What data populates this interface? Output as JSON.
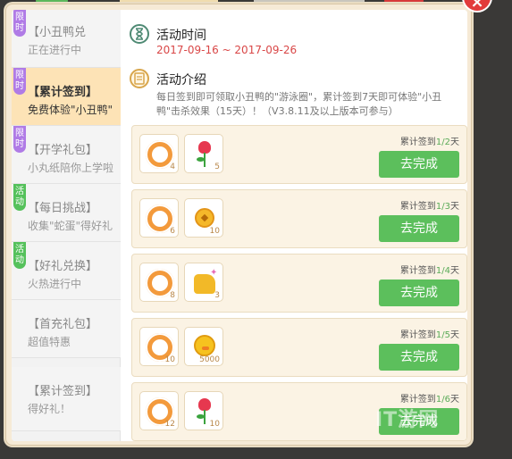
{
  "close_label": "×",
  "sidebar": {
    "items": [
      {
        "tag": "限时",
        "tag_color": "purple",
        "title": "【小丑鸭兑",
        "sub": "正在进行中",
        "active": false
      },
      {
        "tag": "限时",
        "tag_color": "purple",
        "title": "【累计签到】",
        "sub": "免费体验\"小丑鸭\"",
        "active": true
      },
      {
        "tag": "限时",
        "tag_color": "purple",
        "title": "【开学礼包】",
        "sub": "小丸纸陪你上学啦",
        "active": false
      },
      {
        "tag": "活动",
        "tag_color": "green",
        "title": "【每日挑战】",
        "sub": "收集\"蛇蛋\"得好礼",
        "active": false
      },
      {
        "tag": "活动",
        "tag_color": "green",
        "title": "【好礼兑换】",
        "sub": "火热进行中",
        "active": false
      },
      {
        "tag": "",
        "tag_color": "",
        "title": "【首充礼包】",
        "sub": "超值特惠",
        "active": false
      },
      {
        "tag": "",
        "tag_color": "",
        "title": "【累计签到】",
        "sub": "得好礼！",
        "active": false
      }
    ]
  },
  "activity": {
    "time_title": "活动时间",
    "date_range": "2017-09-16 ~ 2017-09-26",
    "intro_title": "活动介绍",
    "intro_text": "每日签到即可领取小丑鸭的\"游泳圈\"，累计签到7天即可体验\"小丑鸭\"击杀效果（15天）！（V3.8.11及以上版本可参与）"
  },
  "tasks": [
    {
      "progress_prefix": "累计签到",
      "progress_value": "1/2",
      "progress_suffix": "天",
      "button": "去完成",
      "rewards": [
        {
          "icon": "swim-ring-icon",
          "count": "4"
        },
        {
          "icon": "rose-icon",
          "count": "5"
        }
      ]
    },
    {
      "progress_prefix": "累计签到",
      "progress_value": "1/3",
      "progress_suffix": "天",
      "button": "去完成",
      "rewards": [
        {
          "icon": "swim-ring-icon",
          "count": "6"
        },
        {
          "icon": "coin-icon",
          "count": "10"
        }
      ]
    },
    {
      "progress_prefix": "累计签到",
      "progress_value": "1/4",
      "progress_suffix": "天",
      "button": "去完成",
      "rewards": [
        {
          "icon": "swim-ring-icon",
          "count": "8"
        },
        {
          "icon": "thumbs-up-icon",
          "count": "3"
        }
      ]
    },
    {
      "progress_prefix": "累计签到",
      "progress_value": "1/5",
      "progress_suffix": "天",
      "button": "去完成",
      "rewards": [
        {
          "icon": "swim-ring-icon",
          "count": "10"
        },
        {
          "icon": "duck-coin-icon",
          "count": "5000"
        }
      ]
    },
    {
      "progress_prefix": "累计签到",
      "progress_value": "1/6",
      "progress_suffix": "天",
      "button": "去完成",
      "rewards": [
        {
          "icon": "swim-ring-icon",
          "count": "12"
        },
        {
          "icon": "rose-icon",
          "count": "10"
        }
      ]
    }
  ],
  "watermark": "IT游网",
  "colors": {
    "accent_green": "#5cbf5c",
    "date_red": "#d94747",
    "active_tab": "#fde3b6"
  }
}
